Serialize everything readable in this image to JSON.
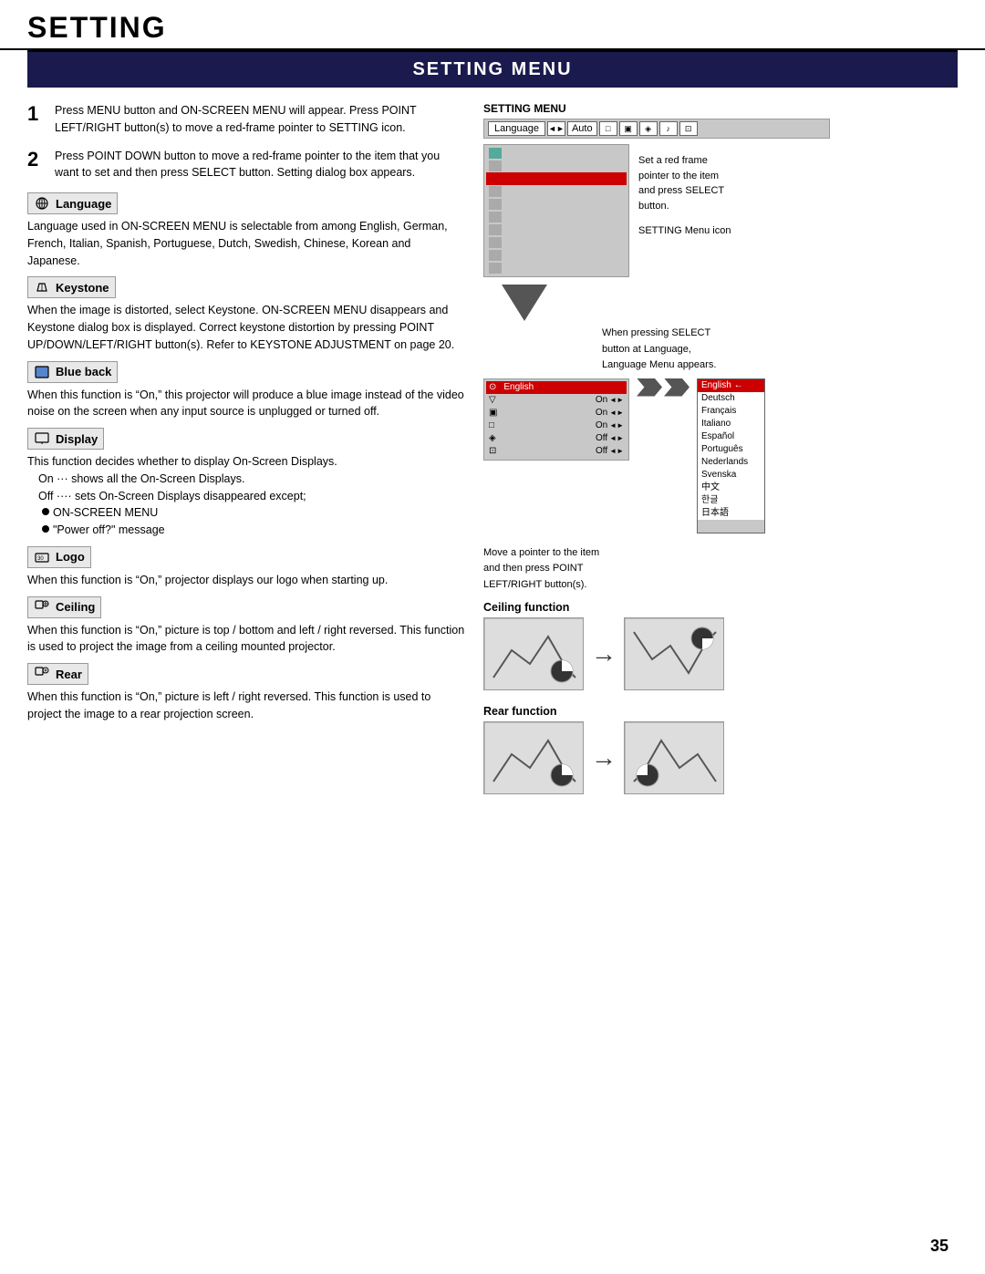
{
  "page": {
    "title": "SETTING",
    "section_title": "SETTING MENU",
    "page_number": "35"
  },
  "steps": [
    {
      "num": "1",
      "text": "Press MENU button and ON-SCREEN MENU will appear.  Press POINT LEFT/RIGHT button(s) to move a red-frame pointer to SETTING icon."
    },
    {
      "num": "2",
      "text": "Press POINT DOWN button to move a red-frame pointer to the item that you want to set and then press SELECT button.  Setting dialog box appears."
    }
  ],
  "features": [
    {
      "id": "language",
      "title": "Language",
      "icon": "globe",
      "text": "Language used in ON-SCREEN MENU is selectable from among English, German, French, Italian, Spanish, Portuguese, Dutch, Swedish, Chinese, Korean and Japanese."
    },
    {
      "id": "keystone",
      "title": "Keystone",
      "icon": "keystone",
      "text": "When the image is distorted, select Keystone.  ON-SCREEN MENU disappears and Keystone dialog box is displayed.  Correct keystone distortion by pressing POINT UP/DOWN/LEFT/RIGHT button(s).  Refer to KEYSTONE ADJUSTMENT on page 20."
    },
    {
      "id": "blueback",
      "title": "Blue back",
      "icon": "blueback",
      "text": "When this function is “On,” this projector will produce a blue image instead of the video noise on the screen when any input source is unplugged or turned off."
    },
    {
      "id": "display",
      "title": "Display",
      "icon": "display",
      "text_parts": [
        "This function decides whether to display On-Screen Displays.",
        "On ··· shows all the On-Screen Displays.",
        "Off ···· sets On-Screen Displays disappeared except;",
        "ON-SCREEN MENU",
        "“Power off?” message"
      ]
    },
    {
      "id": "logo",
      "title": "Logo",
      "icon": "logo",
      "text": "When this function is “On,” projector displays our logo when starting up."
    },
    {
      "id": "ceiling",
      "title": "Ceiling",
      "icon": "ceiling",
      "text": "When this function is “On,” picture is top / bottom and left / right reversed.  This function is used to project the image from a ceiling mounted projector."
    },
    {
      "id": "rear",
      "title": "Rear",
      "icon": "rear",
      "text": "When this function is “On,” picture is left / right reversed.  This function is used to project the image to a rear projection screen."
    }
  ],
  "right_panel": {
    "setting_menu_label": "SETTING MENU",
    "menu_tab": "Language",
    "menu_auto": "Auto",
    "set_red_frame_text": "Set a red frame\npointer to the item\nand press SELECT\nbutton.",
    "setting_menu_icon_label": "SETTING Menu icon",
    "on_select_language": "When pressing SELECT\nbutton at Language,\nLanguage Menu appears.",
    "language_current": "English",
    "language_list": [
      {
        "name": "English",
        "selected": true
      },
      {
        "name": "Deutsch",
        "selected": false
      },
      {
        "name": "Français",
        "selected": false
      },
      {
        "name": "Italiano",
        "selected": false
      },
      {
        "name": "Español",
        "selected": false
      },
      {
        "name": "Português",
        "selected": false
      },
      {
        "name": "Nederlands",
        "selected": false
      },
      {
        "name": "Svenska",
        "selected": false
      },
      {
        "name": "中文",
        "selected": false
      },
      {
        "name": "한글",
        "selected": false
      },
      {
        "name": "日本語",
        "selected": false
      }
    ],
    "move_pointer_text": "Move a pointer to the item\nand then press POINT\nLEFT/RIGHT button(s).",
    "ui_rows": [
      {
        "icon": true,
        "label": "Language",
        "value": ""
      },
      {
        "icon": true,
        "label": "",
        "value": ""
      },
      {
        "icon": true,
        "label": "",
        "value": ""
      },
      {
        "icon": true,
        "label": "",
        "value": ""
      },
      {
        "icon": true,
        "label": "",
        "value": ""
      },
      {
        "icon": true,
        "label": "",
        "value": "On"
      },
      {
        "icon": true,
        "label": "",
        "value": "On"
      },
      {
        "icon": true,
        "label": "",
        "value": "On"
      },
      {
        "icon": true,
        "label": "",
        "value": "Off"
      },
      {
        "icon": true,
        "label": "",
        "value": "Off"
      }
    ],
    "ceiling_function_label": "Ceiling function",
    "rear_function_label": "Rear function"
  }
}
